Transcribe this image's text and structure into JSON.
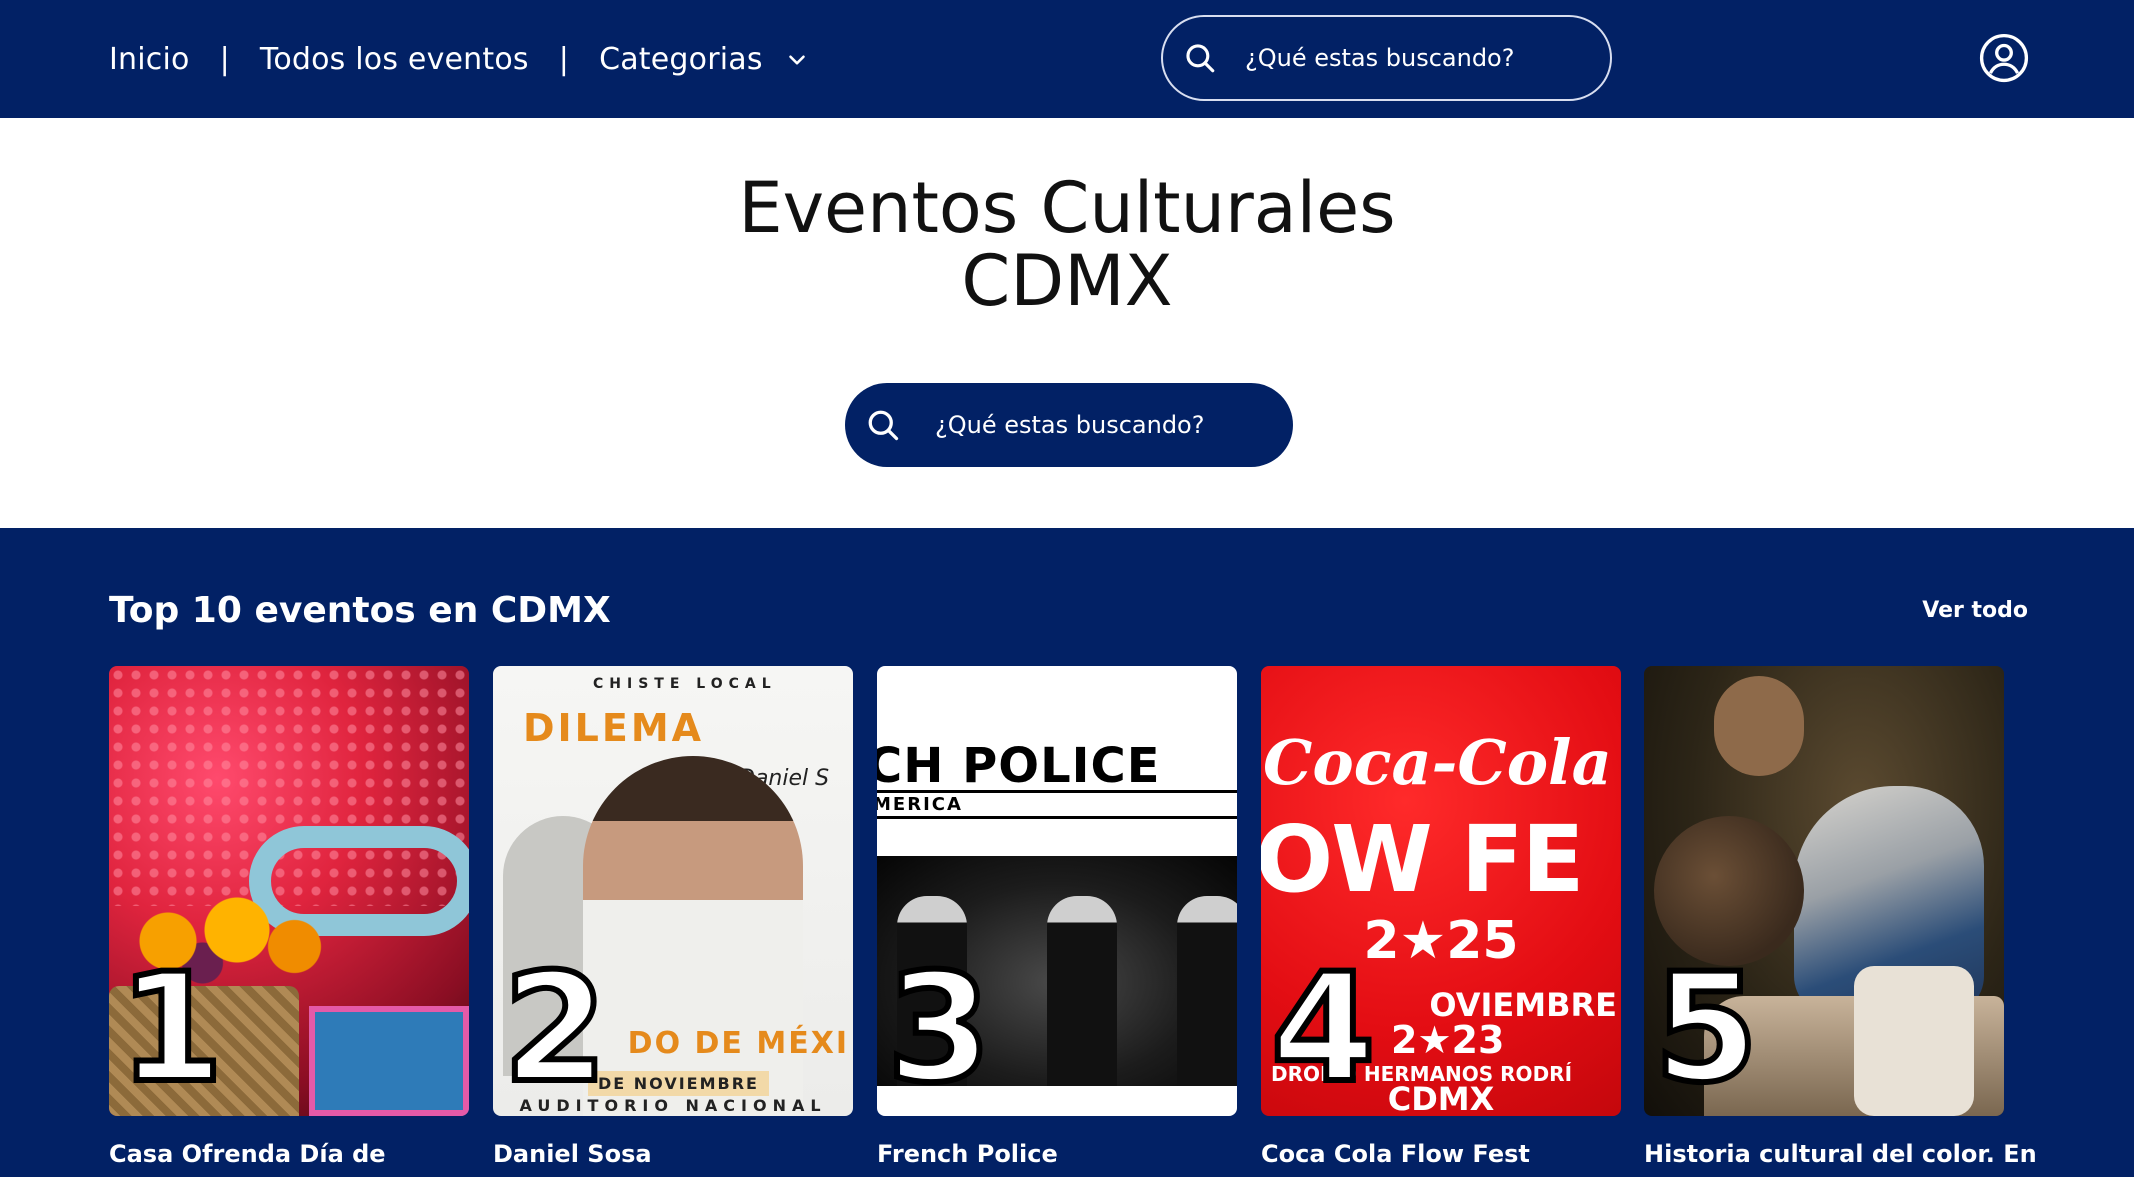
{
  "nav": {
    "items": [
      "Inicio",
      "Todos los eventos",
      "Categorias"
    ],
    "separator": "|"
  },
  "top_search": {
    "placeholder": "¿Qué estas buscando?"
  },
  "hero": {
    "title_line1": "Eventos Culturales",
    "title_line2": "CDMX",
    "search_placeholder": "¿Qué estas buscando?"
  },
  "top10": {
    "title": "Top 10 eventos en CDMX",
    "see_all": "Ver todo",
    "cards": [
      {
        "rank": "1",
        "title": "Casa Ofrenda Día de"
      },
      {
        "rank": "2",
        "title": "Daniel Sosa"
      },
      {
        "rank": "3",
        "title": "French Police"
      },
      {
        "rank": "4",
        "title": "Coca Cola Flow Fest"
      },
      {
        "rank": "5",
        "title": "Historia cultural del color. En"
      }
    ]
  },
  "posters": {
    "p2": {
      "brand": "CHISTE LOCAL",
      "headline": "DILEMA",
      "signature": "Daniel S",
      "band": "DO DE MÉXI",
      "date": "DE NOVIEMBRE",
      "venue": "AUDITORIO NACIONAL"
    },
    "p3": {
      "headline": "CH POLICE",
      "sub": "MERICA"
    },
    "p4": {
      "logo": "Coca-Cola",
      "headline": "OW FE",
      "year": "2★25",
      "month": "OVIEMBRE",
      "dates": "2★23",
      "venue": "DROMO HERMANOS RODRÍ",
      "city": "CDMX"
    }
  },
  "colors": {
    "brand_navy": "#022165",
    "white": "#ffffff"
  },
  "icons": {
    "search": "search-icon",
    "chevron": "chevron-down-icon",
    "user": "user-circle-icon"
  }
}
